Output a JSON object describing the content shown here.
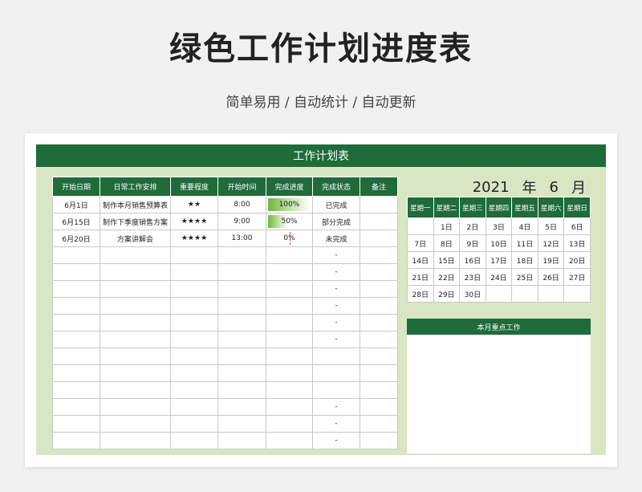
{
  "title": "绿色工作计划进度表",
  "subtitle": "简单易用 / 自动统计 / 自动更新",
  "sheet_title": "工作计划表",
  "table": {
    "headers": [
      "开始日期",
      "日常工作安排",
      "重要程度",
      "开始时间",
      "完成进度",
      "完成状态",
      "备注"
    ],
    "rows": [
      {
        "date": "6月1日",
        "task": "制作本月销售预算表",
        "importance": "★★",
        "time": "8:00",
        "progress": "100%",
        "progress_value": 1.0,
        "status": "已完成",
        "note": ""
      },
      {
        "date": "6月15日",
        "task": "制作下季度销售方案",
        "importance": "★★★★",
        "time": "9:00",
        "progress": "50%",
        "progress_value": 0.5,
        "status": "部分完成",
        "note": ""
      },
      {
        "date": "6月20日",
        "task": "方案讲解会",
        "importance": "★★★★",
        "time": "13:00",
        "progress": "0%",
        "progress_value": 0.0,
        "status": "未完成",
        "note": ""
      },
      {
        "status": "-"
      },
      {
        "status": "-"
      },
      {
        "status": "-"
      },
      {
        "status": "-"
      },
      {
        "status": "-"
      },
      {
        "status": "-"
      },
      {
        "status": ""
      },
      {
        "status": ""
      },
      {
        "status": ""
      },
      {
        "status": "-"
      },
      {
        "status": "-"
      },
      {
        "status": "-"
      }
    ]
  },
  "calendar": {
    "year": "2021",
    "year_label": "年",
    "month": "6",
    "month_label": "月",
    "weekdays": [
      "星期一",
      "星期二",
      "星期三",
      "星期四",
      "星期五",
      "星期六",
      "星期日"
    ],
    "weeks": [
      [
        "",
        "1日",
        "2日",
        "3日",
        "4日",
        "5日",
        "6日"
      ],
      [
        "7日",
        "8日",
        "9日",
        "10日",
        "11日",
        "12日",
        "13日"
      ],
      [
        "14日",
        "15日",
        "16日",
        "17日",
        "18日",
        "19日",
        "20日"
      ],
      [
        "21日",
        "22日",
        "23日",
        "24日",
        "25日",
        "26日",
        "27日"
      ],
      [
        "28日",
        "29日",
        "30日",
        "",
        "",
        "",
        ""
      ]
    ]
  },
  "focus_title": "本月重点工作",
  "colors": {
    "accent": "#1f6b3a",
    "sheet_bg": "#d8e6c4",
    "progress": "#6fb53f"
  }
}
